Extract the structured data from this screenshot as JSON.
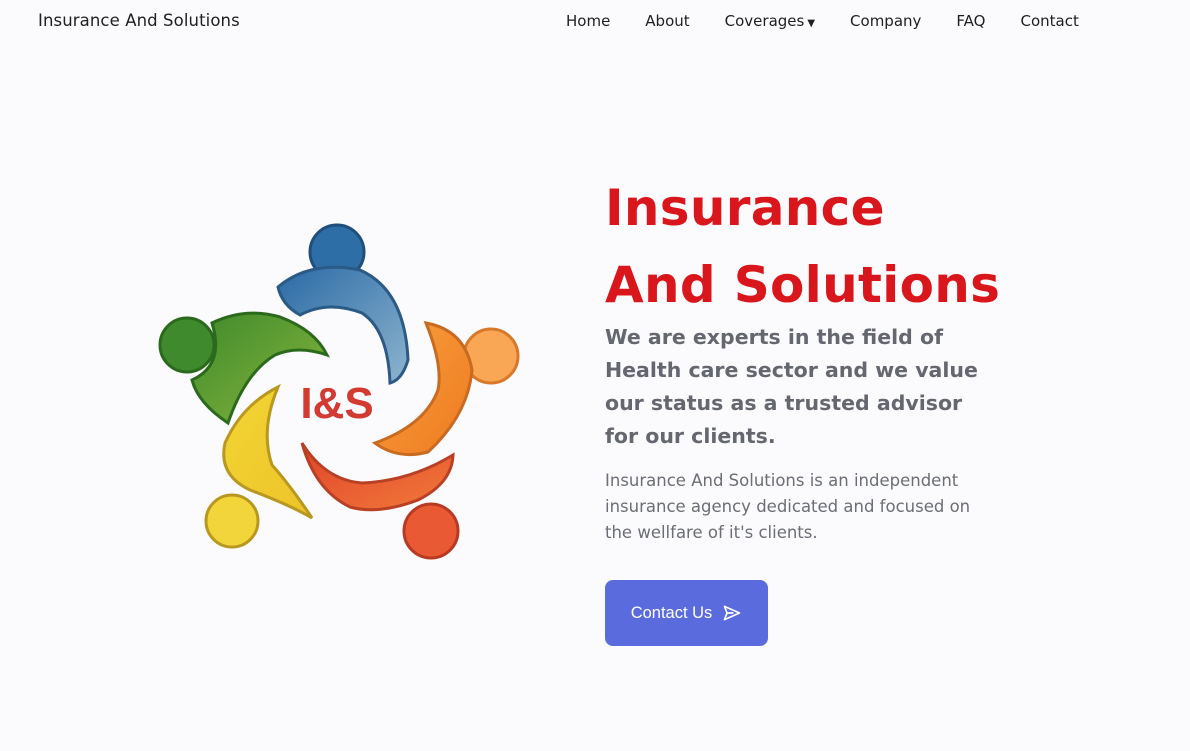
{
  "nav": {
    "brand": "Insurance And Solutions",
    "items": [
      {
        "label": "Home"
      },
      {
        "label": "About"
      },
      {
        "label": "Coverages",
        "has_dropdown": true
      },
      {
        "label": "Company"
      },
      {
        "label": "FAQ"
      },
      {
        "label": "Contact"
      }
    ],
    "dropdown_icon": "caret-down-icon"
  },
  "logo": {
    "text": "I&S",
    "colors": {
      "blue": "#3b76a8",
      "orange": "#f0862a",
      "red": "#e3552e",
      "yellow": "#f1cf2f",
      "green": "#4d8f2e",
      "text": "#d23a32"
    }
  },
  "hero": {
    "title_line1": "Insurance",
    "title_line2": "And Solutions",
    "lead": "We are experts in the field of Health care sector and we value our status as a trusted advisor for our clients.",
    "description": "Insurance And Solutions is an independent insurance agency dedicated and focused on the wellfare of it's clients.",
    "cta_label": "Contact Us",
    "cta_icon": "send-icon"
  },
  "colors": {
    "title": "#d9161b",
    "cta_bg": "#5a6bde",
    "background": "#fbfafc"
  }
}
